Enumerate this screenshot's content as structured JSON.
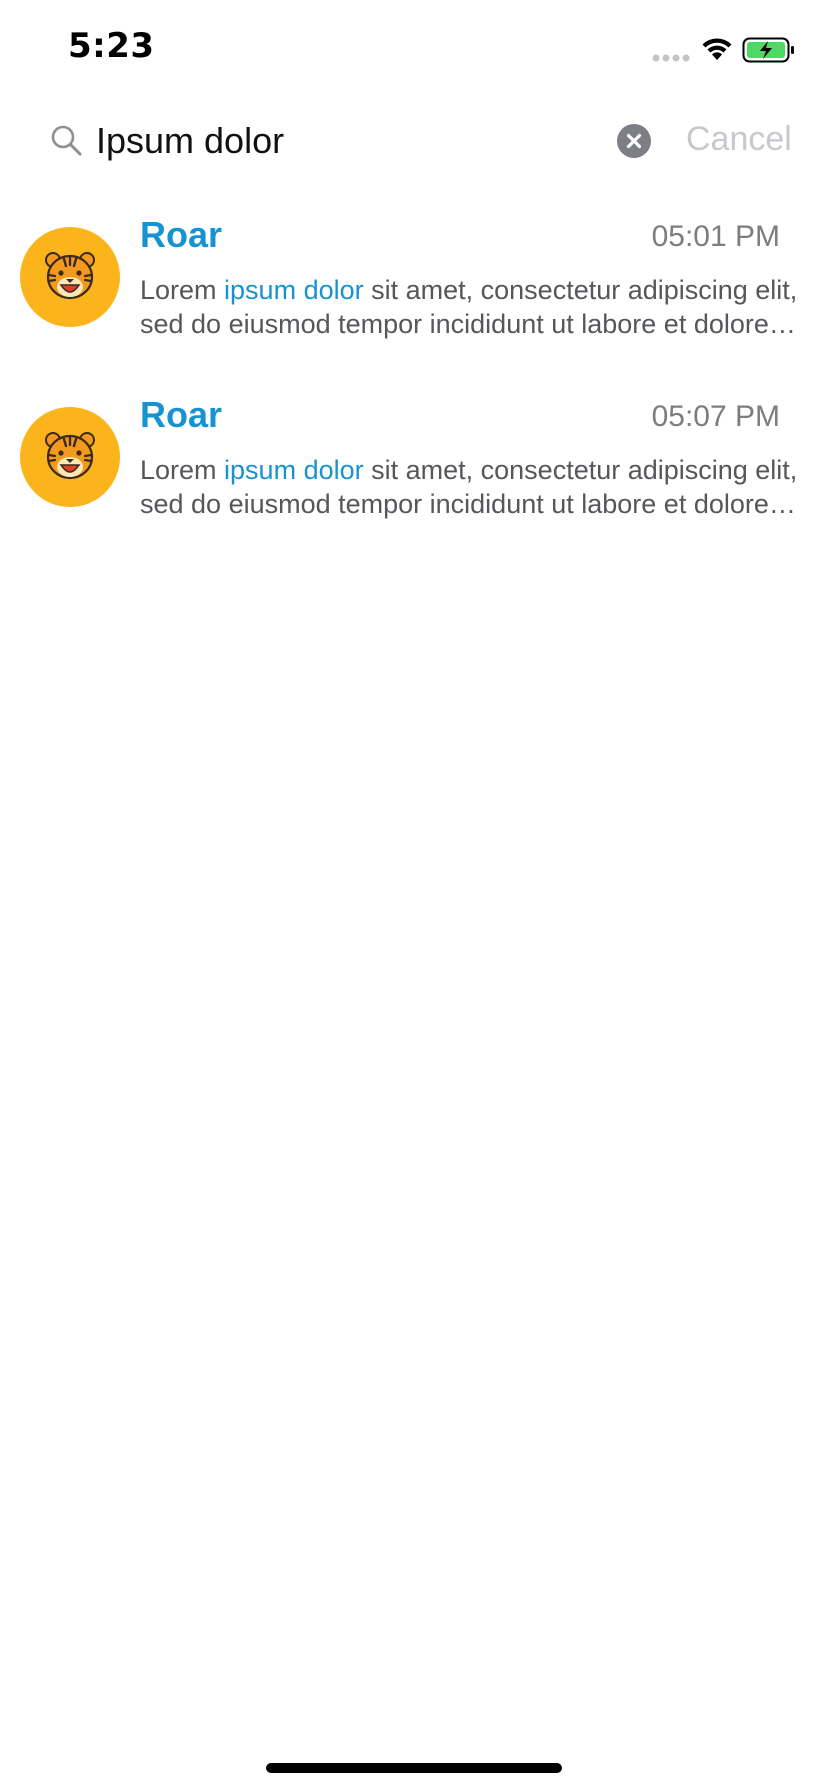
{
  "status_bar": {
    "time": "5:23"
  },
  "search": {
    "query": "Ipsum dolor",
    "cancel_label": "Cancel"
  },
  "results": [
    {
      "sender": "Roar",
      "time": "05:01 PM",
      "preview_before": "Lorem ",
      "preview_match": "ipsum dolor",
      "preview_after": " sit amet, consectetur adipiscing elit, sed do eiusmod tempor incididunt ut labore et dolore magna aliqua."
    },
    {
      "sender": "Roar",
      "time": "05:07 PM",
      "preview_before": "Lorem ",
      "preview_match": "ipsum dolor",
      "preview_after": " sit amet, consectetur adipiscing elit, sed do eiusmod tempor incididunt ut labore et dolore magna aliqua."
    }
  ],
  "icons": {
    "avatar": "tiger-face-icon",
    "search": "search-icon",
    "clear": "clear-circle-icon",
    "wifi": "wifi-icon",
    "battery": "battery-charging-icon"
  },
  "colors": {
    "accent": "#1893d1",
    "avatar_bg": "#fbb41b",
    "timestamp": "#7b7d80",
    "cancel": "#c8c9cc",
    "battery_fill": "#4cd964"
  }
}
